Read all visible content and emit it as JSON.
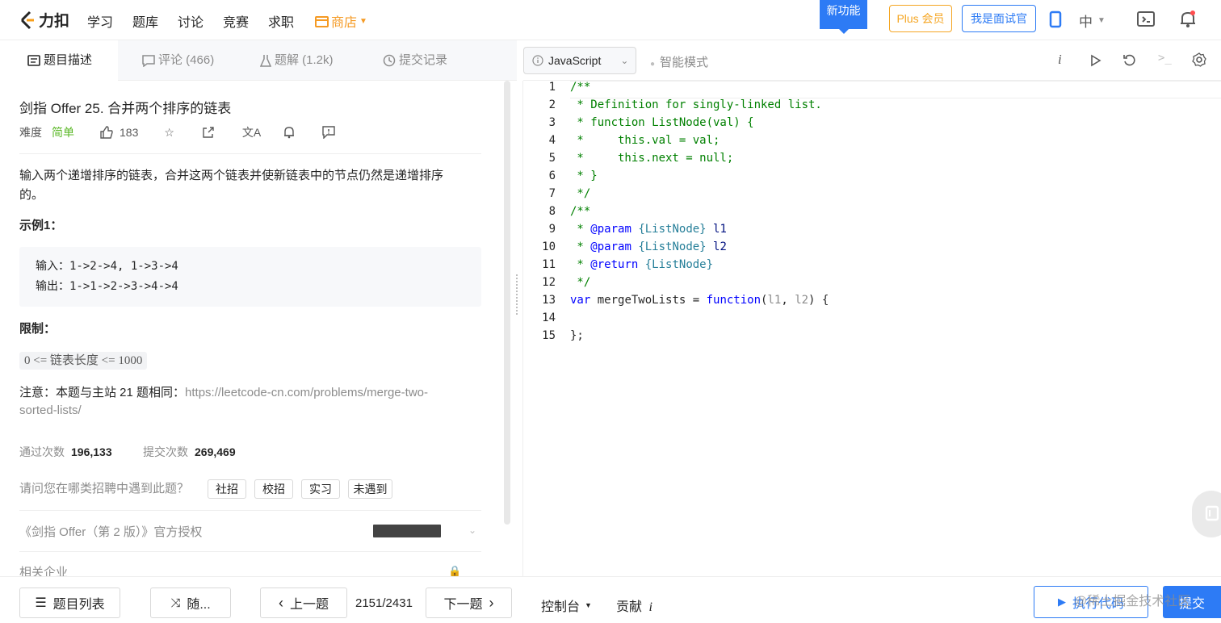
{
  "nav": {
    "logo_text": "力扣",
    "items": [
      "学习",
      "题库",
      "讨论",
      "竞赛",
      "求职"
    ],
    "shop": "商店",
    "new_feature": "新功能",
    "plus": "Plus 会员",
    "interviewer": "我是面试官",
    "lang": "中"
  },
  "tabs": [
    {
      "label": "题目描述"
    },
    {
      "label": "评论 (466)"
    },
    {
      "label": "题解 (1.2k)"
    },
    {
      "label": "提交记录"
    }
  ],
  "problem": {
    "title": "剑指 Offer 25. 合并两个排序的链表",
    "difficulty_label": "难度",
    "difficulty": "简单",
    "likes": "183",
    "description_line1": "输入两个递增排序的链表，合并这两个链表并使新链表中的节点仍然是递增排序",
    "description_line2": "的。",
    "example_title": "示例1：",
    "example_input": "输入：1->2->4, 1->3->4",
    "example_output": "输出：1->1->2->3->4->4",
    "limit_title": "限制：",
    "limit": "0 <= 链表长度 <= 1000",
    "note_prefix": "注意：本题与主站 21 题相同：",
    "note_link_line1": "https://leetcode-cn.com/problems/merge-two-",
    "note_link_line2": "sorted-lists/",
    "accepted_label": "通过次数",
    "accepted": "196,133",
    "submitted_label": "提交次数",
    "submitted": "269,469",
    "recruit_question": "请问您在哪类招聘中遇到此题？",
    "recruit_options": [
      "社招",
      "校招",
      "实习",
      "未遇到"
    ],
    "book_auth": "《剑指 Offer（第 2 版）》官方授权",
    "related": "相关企业"
  },
  "editor": {
    "language": "JavaScript",
    "smart_mode": "智能模式",
    "line_numbers": [
      "1",
      "2",
      "3",
      "4",
      "5",
      "6",
      "7",
      "8",
      "9",
      "10",
      "11",
      "12",
      "13",
      "14",
      "15"
    ]
  },
  "bottom": {
    "problem_list": "题目列表",
    "random": "随...",
    "prev": "上一题",
    "progress": "2151/2431",
    "next": "下一题",
    "console": "控制台",
    "contribute": "贡献",
    "run": "执行代码",
    "submit": "提交",
    "watermark": "@稀土掘金技术社区"
  },
  "colors": {
    "accent": "#2d7bf5",
    "easy": "#5ab726",
    "shop": "#f59a23"
  }
}
